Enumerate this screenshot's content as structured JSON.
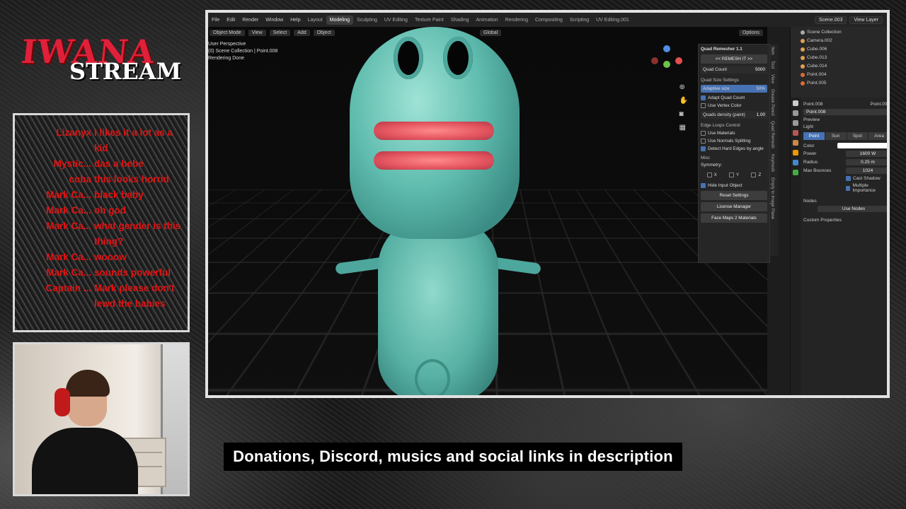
{
  "logo": {
    "top": "IWANA",
    "bottom": "STREAM"
  },
  "chat": [
    {
      "user": "Lizanyx",
      "msg": "I likes it a lot as a kid"
    },
    {
      "user": "Mystic...",
      "msg": "das a bebe"
    },
    {
      "user": "coba",
      "msg": "this looks horrid"
    },
    {
      "user": "Mark Ca...",
      "msg": "black baby"
    },
    {
      "user": "Mark Ca...",
      "msg": "oh god"
    },
    {
      "user": "Mark Ca...",
      "msg": "what gender is this thing?"
    },
    {
      "user": "Mark Ca...",
      "msg": "wooow"
    },
    {
      "user": "Mark Ca...",
      "msg": "sounds powerful"
    },
    {
      "user": "Captain ...",
      "msg": "Mark please don't lewd the babies"
    }
  ],
  "blender": {
    "menus": [
      "File",
      "Edit",
      "Render",
      "Window",
      "Help"
    ],
    "workspaces": [
      "Layout",
      "Modeling",
      "Sculpting",
      "UV Editing",
      "Texture Paint",
      "Shading",
      "Animation",
      "Rendering",
      "Compositing",
      "Scripting",
      "UV Editing.001"
    ],
    "active_workspace": "Modeling",
    "scene": "Scene.003",
    "view_layer": "View Layer",
    "viewport": {
      "header": [
        "Object Mode",
        "View",
        "Select",
        "Add",
        "Object"
      ],
      "orientation": "Global",
      "options": "Options",
      "info": [
        "User Perspective",
        "(0) Scene Collection | Point.008",
        "Rendering Done"
      ]
    },
    "npanel": {
      "title": "Quad Remesher 1.1",
      "remesh": "<< REMESH IT >>",
      "quad_count_label": "Quad Count",
      "quad_count": "5000",
      "quad_size_settings": "Quad Size Settings",
      "adaptive_size_label": "Adaptive size",
      "adaptive_size": "50%",
      "adapt_quad_count": "Adapt Quad Count",
      "use_vertex_color": "Use Vertex Color",
      "quads_density_label": "Quads density (paint)",
      "quads_density": "1.00",
      "edge_loops_control": "Edge Loops Control",
      "use_materials": "Use Materials",
      "use_normals_splitting": "Use Normals Splitting",
      "detect_hard_edges": "Detect Hard Edges by angle",
      "misc": "Misc",
      "symmetry": "Symmetry:",
      "sym": [
        "X",
        "Y",
        "Z"
      ],
      "hide_input": "Hide Input Object",
      "reset": "Reset Settings",
      "license": "License Manager",
      "face_maps": "Face Maps 2 Materials",
      "tabs": [
        "Item",
        "Tool",
        "View",
        "Grease Pencil",
        "Quad Remesh",
        "Keymesh",
        "Empty to Image Plane"
      ]
    },
    "outliner": {
      "root": "Scene Collection",
      "items": [
        "Camera.002",
        "Cube.006",
        "Cube.013",
        "Cube.014",
        "Point.004",
        "Point.005"
      ]
    },
    "properties": {
      "object": "Point.008",
      "data": "Point.008",
      "datablock": "Point.008",
      "preview": "Preview",
      "light": "Light",
      "types": [
        "Point",
        "Sun",
        "Spot",
        "Area"
      ],
      "active_type": "Point",
      "color_label": "Color",
      "power_label": "Power",
      "power": "1600 W",
      "radius_label": "Radius",
      "radius": "0.25 m",
      "bounces_label": "Max Bounces",
      "bounces": "1024",
      "cast_shadow": "Cast Shadow",
      "multiple_importance": "Multiple Importance",
      "nodes": "Nodes",
      "use_nodes": "Use Nodes",
      "custom_props": "Custom Properties"
    }
  },
  "caption": "Donations, Discord, musics and social links in description",
  "colors": {
    "chat_text": "#e31212",
    "accent": "#4772b3",
    "logo_red": "#e0203a"
  }
}
